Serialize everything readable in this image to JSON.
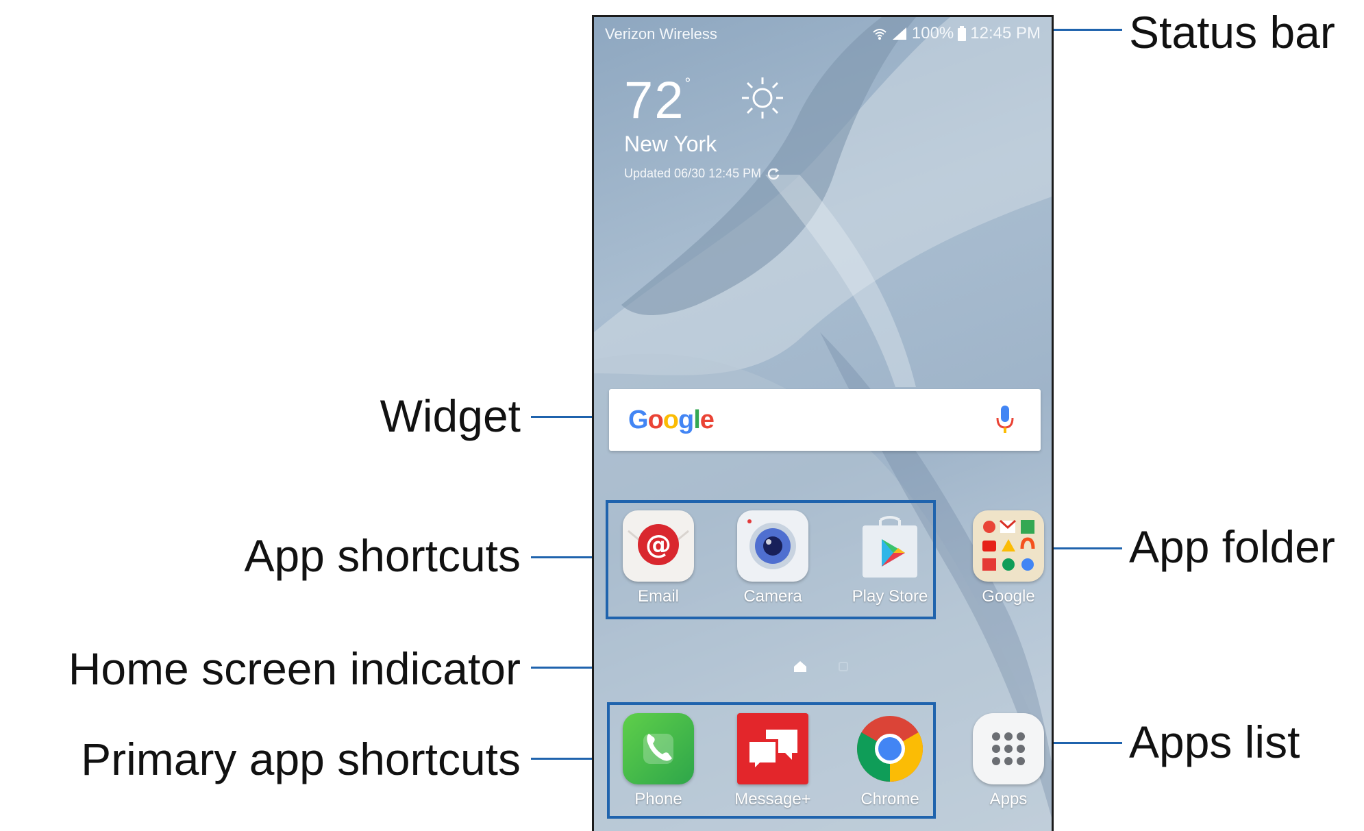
{
  "callouts": {
    "status_bar": "Status bar",
    "widget": "Widget",
    "app_shortcuts": "App shortcuts",
    "app_folder": "App folder",
    "home_screen_indicator": "Home screen indicator",
    "primary_app_shortcuts": "Primary app shortcuts",
    "apps_list": "Apps list"
  },
  "status_bar": {
    "carrier": "Verizon Wireless",
    "battery": "100%",
    "time": "12:45 PM"
  },
  "weather": {
    "temperature": "72",
    "degree": "°",
    "city": "New York",
    "updated": "Updated 06/30 12:45 PM"
  },
  "search_widget": {
    "logo_letters": [
      "G",
      "o",
      "o",
      "g",
      "l",
      "e"
    ],
    "logo_colors": [
      "#4285F4",
      "#EA4335",
      "#FBBC05",
      "#4285F4",
      "#34A853",
      "#EA4335"
    ]
  },
  "app_shortcuts": [
    {
      "label": "Email",
      "icon": "email-icon"
    },
    {
      "label": "Camera",
      "icon": "camera-icon"
    },
    {
      "label": "Play Store",
      "icon": "play-store-icon"
    }
  ],
  "app_folder": {
    "label": "Google",
    "icon": "google-folder-icon"
  },
  "home_indicator": {
    "pages": 2,
    "current": 1
  },
  "primary_shortcuts": [
    {
      "label": "Phone",
      "icon": "phone-icon"
    },
    {
      "label": "Message+",
      "icon": "message-plus-icon"
    },
    {
      "label": "Chrome",
      "icon": "chrome-icon"
    }
  ],
  "apps_list": {
    "label": "Apps",
    "icon": "apps-grid-icon"
  },
  "colors": {
    "callout_line": "#1f63ad",
    "wallpaper": "#9fb4c9"
  }
}
